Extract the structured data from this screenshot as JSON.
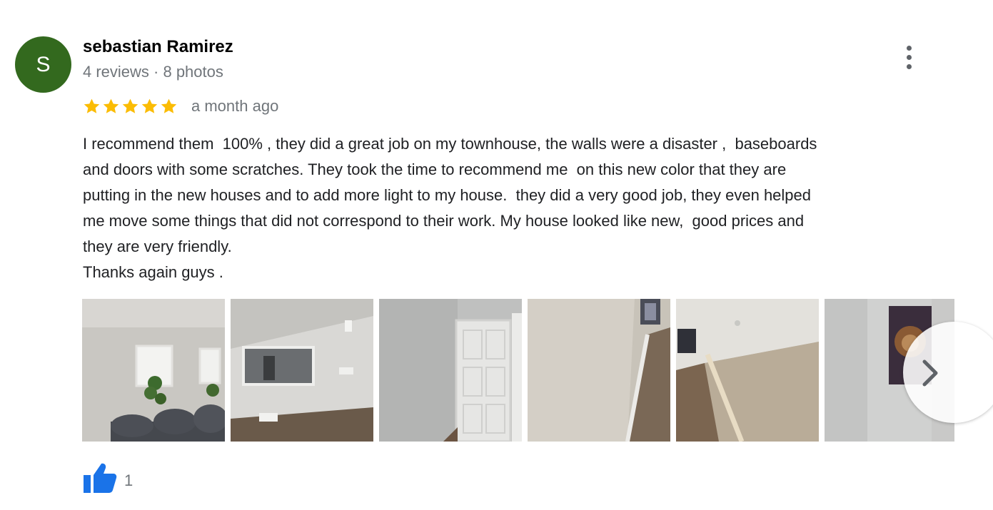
{
  "review": {
    "avatar_initial": "S",
    "author_name": "sebastian Ramirez",
    "author_meta": "4 reviews · 8 photos",
    "rating": 5,
    "rating_max": 5,
    "date": "a month ago",
    "text": "I recommend them  100% , they did a great job on my townhouse, the walls were a disaster ,  baseboards\nand doors with some scratches. They took the time to recommend me  on this new color that they are\nputting in the new houses and to add more light to my house.  they did a very good job, they even helped\nme move some things that did not correspond to their work. My house looked like new,  good prices and\nthey are very friendly.\nThanks again guys .",
    "likes": "1"
  },
  "colors": {
    "avatar": "#33691e",
    "star": "#fbbc04",
    "like": "#1a73e8",
    "secondary_text": "#70757a"
  },
  "icons": {
    "menu": "more-vert-icon",
    "star": "star-icon",
    "next": "chevron-right-icon",
    "like": "thumb-up-icon"
  }
}
